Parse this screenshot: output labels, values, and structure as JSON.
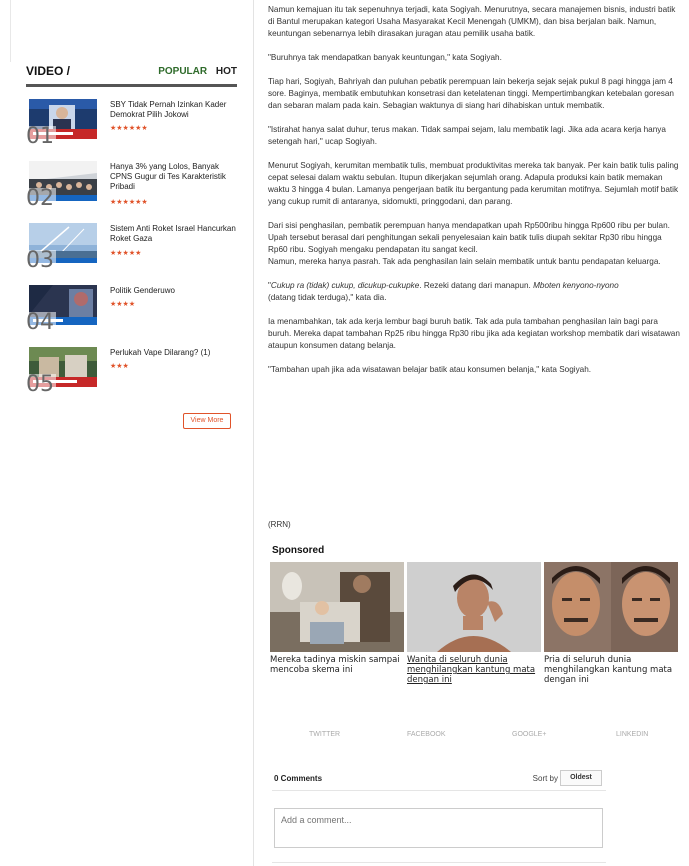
{
  "sidebar": {
    "title": "VIDEO /",
    "tabs": [
      "POPULAR",
      "HOT"
    ],
    "videos": [
      {
        "rank": "01",
        "title": "SBY Tidak Pernah Izinkan Kader Demokrat Pilih Jokowi",
        "rating": 6
      },
      {
        "rank": "02",
        "title": "Hanya 3% yang Lolos, Banyak CPNS Gugur di Tes Karakteristik Pribadi",
        "rating": 6
      },
      {
        "rank": "03",
        "title": "Sistem Anti Roket Israel Hancurkan Roket Gaza",
        "rating": 5
      },
      {
        "rank": "04",
        "title": "Politik Genderuwo",
        "rating": 4
      },
      {
        "rank": "05",
        "title": "Perlukah Vape Dilarang? (1)",
        "rating": 3
      }
    ],
    "view_more": "View More"
  },
  "article": {
    "p1": "Namun kemajuan itu tak sepenuhnya terjadi, kata Sogiyah. Menurutnya, secara manajemen bisnis, industri batik di Bantul merupakan kategori Usaha Masyarakat Kecil Menengah (UMKM), dan bisa berjalan baik. Namun, keuntungan sebenarnya lebih dirasakan juragan atau pemilik usaha batik.",
    "p2": "\"Buruhnya tak mendapatkan banyak keuntungan,\" kata Sogiyah.",
    "p3": "Tiap hari, Sogiyah, Bahriyah dan puluhan pebatik perempuan lain bekerja sejak sejak pukul 8 pagi hingga jam 4 sore. Baginya, membatik embutuhkan konsetrasi dan ketelatenan tinggi. Mempertimbangkan ketebalan goresan dan sebaran malam pada kain. Sebagian waktunya di siang hari dihabiskan untuk membatik.",
    "p4": "\"Istirahat hanya salat duhur, terus makan. Tidak sampai sejam, lalu membatik lagi. Jika ada acara kerja hanya setengah hari,\" ucap Sogiyah.",
    "p5": "Menurut Sogiyah, kerumitan membatik tulis, membuat produktivitas mereka tak banyak. Per kain batik tulis paling cepat selesai dalam waktu sebulan. Itupun dikerjakan sejumlah orang. Adapula produksi kain batik memakan waktu 3 hingga 4 bulan. Lamanya pengerjaan batik itu bergantung pada kerumitan motifnya. Sejumlah motif batik yang cukup rumit di antaranya, sidomukti, pringgodani, dan parang.",
    "p6": "Dari sisi penghasilan, pembatik perempuan hanya mendapatkan upah Rp500ribu hingga Rp600 ribu per bulan. Upah tersebut berasal dari penghitungan sekali penyelesaian kain batik tulis diupah sekitar Rp30 ribu hingga Rp60 ribu. Sogiyah mengaku pendapatan itu sangat kecil.\nNamun, mereka hanya pasrah. Tak ada penghasilan lain selain membatik untuk bantu pendapatan keluarga.",
    "p7_q": "\"",
    "p7_i1": "Cukup ra (tidak) cukup, dicukup-cukupke",
    "p7_m": ". Rezeki datang dari manapun. ",
    "p7_i2": "Mboten kenyono-nyono",
    "p7_e": "\n(datang tidak terduga),\" kata dia.",
    "p8": "Ia menambahkan, tak ada kerja lembur bagi buruh batik. Tak ada pula tambahan penghasilan lain bagi para buruh. Mereka dapat tambahan Rp25 ribu hingga Rp30 ribu jika ada kegiatan workshop membatik dari wisatawan ataupun konsumen datang belanja.",
    "p9": "\"Tambahan upah jika ada wisatawan belajar batik atau konsumen belanja,\" kata Sogiyah.",
    "source": "(RRN)"
  },
  "sponsored": {
    "title": "Sponsored",
    "cards": [
      {
        "caption": "Mereka tadinya miskin sampai mencoba skema ini"
      },
      {
        "caption": "Wanita di seluruh dunia menghilangkan kantung mata dengan ini"
      },
      {
        "caption": "Pria di seluruh dunia menghilangkan kantung mata dengan ini"
      }
    ]
  },
  "share": [
    "TWITTER",
    "FACEBOOK",
    "GOOGLE+",
    "LINKEDIN"
  ],
  "comments": {
    "count_label": "0 Comments",
    "sort_label": "Sort by",
    "sort_value": "Oldest",
    "placeholder": "Add a comment..."
  },
  "colors": {
    "accent": "#e0532a",
    "tab_green": "#2f6b2b"
  }
}
